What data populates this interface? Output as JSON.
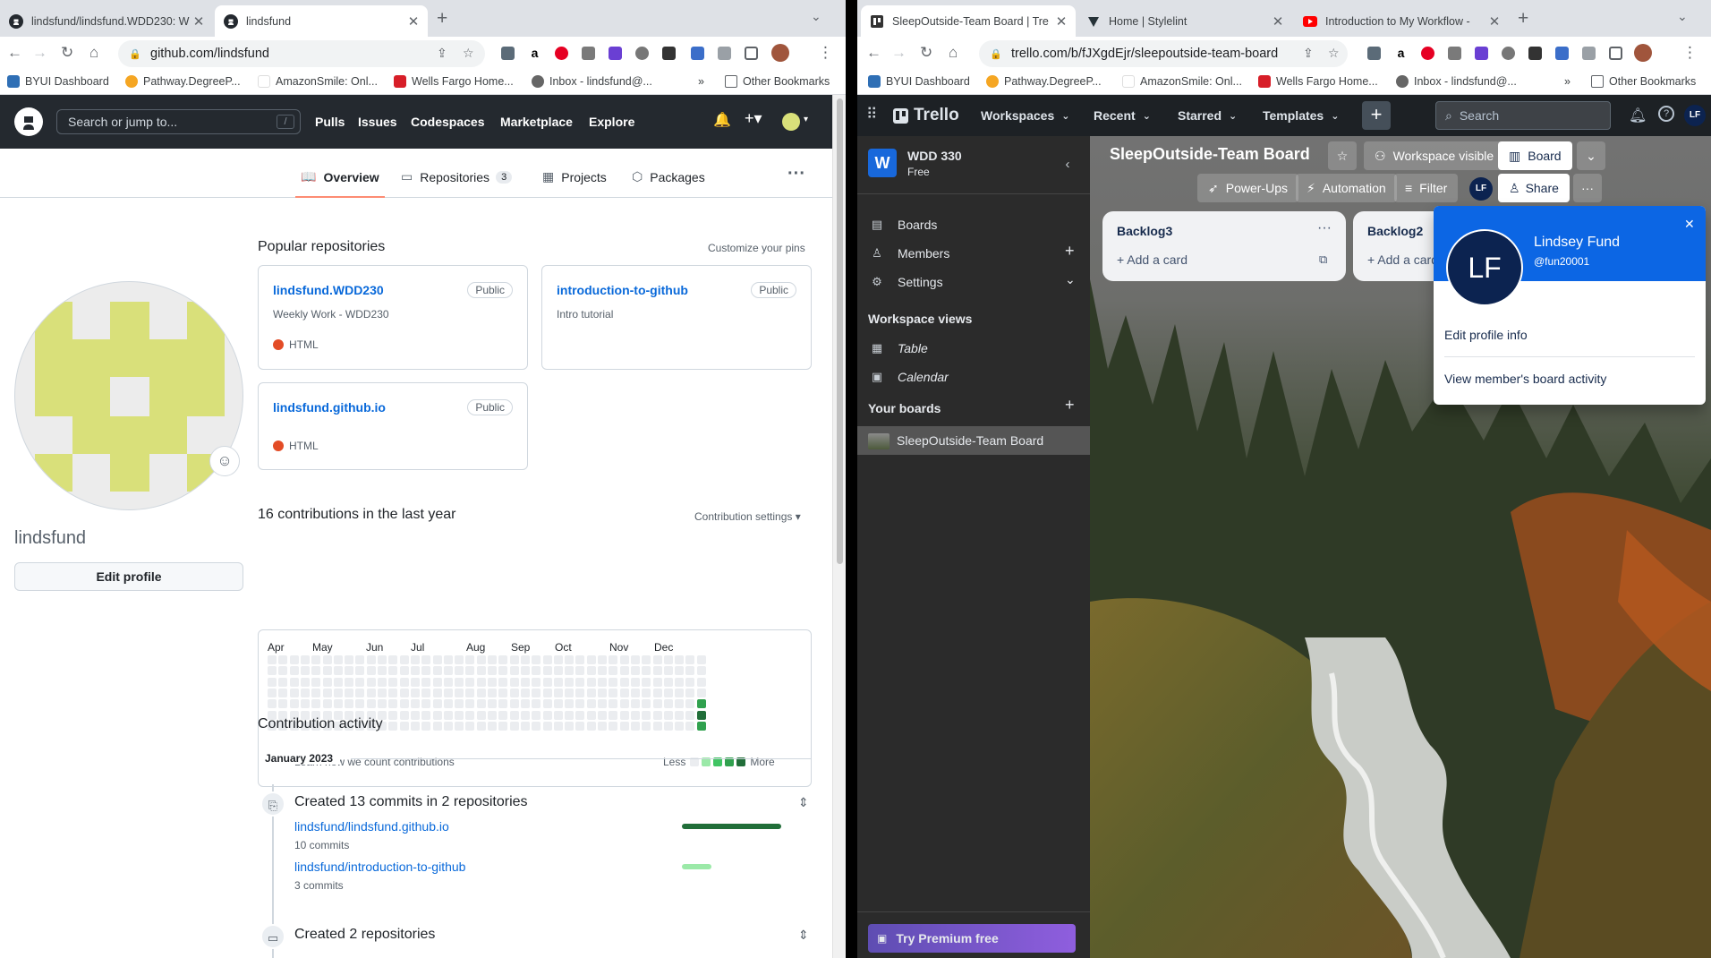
{
  "left_browser": {
    "tabs": [
      {
        "title": "lindsfund/lindsfund.WDD230: W",
        "active": false
      },
      {
        "title": "lindsfund",
        "active": true
      }
    ],
    "url": "github.com/lindsfund",
    "bookmarks": [
      "BYUI Dashboard",
      "Pathway.DegreeP...",
      "AmazonSmile: Onl...",
      "Wells Fargo Home...",
      "Inbox - lindsfund@...",
      "Other Bookmarks"
    ],
    "overflow": "»"
  },
  "right_browser": {
    "tabs": [
      {
        "title": "SleepOutside-Team Board | Tre",
        "active": true
      },
      {
        "title": "Home | Stylelint",
        "active": false
      },
      {
        "title": "Introduction to My Workflow -",
        "active": false
      }
    ],
    "url": "trello.com/b/fJXgdEjr/sleepoutside-team-board",
    "bookmarks": [
      "BYUI Dashboard",
      "Pathway.DegreeP...",
      "AmazonSmile: Onl...",
      "Wells Fargo Home...",
      "Inbox - lindsfund@...",
      "Other Bookmarks"
    ],
    "overflow": "»"
  },
  "github": {
    "search_placeholder": "Search or jump to...",
    "search_key": "/",
    "nav": [
      "Pulls",
      "Issues",
      "Codespaces",
      "Marketplace",
      "Explore"
    ],
    "profile_tabs": [
      {
        "label": "Overview",
        "count": null,
        "active": true
      },
      {
        "label": "Repositories",
        "count": "3",
        "active": false
      },
      {
        "label": "Projects",
        "count": null,
        "active": false
      },
      {
        "label": "Packages",
        "count": null,
        "active": false
      }
    ],
    "username": "lindsfund",
    "edit_profile": "Edit profile",
    "popular_title": "Popular repositories",
    "customize_pins": "Customize your pins",
    "repos": [
      {
        "name": "lindsfund.WDD230",
        "visibility": "Public",
        "description": "Weekly Work - WDD230",
        "language": "HTML"
      },
      {
        "name": "introduction-to-github",
        "visibility": "Public",
        "description": "Intro tutorial",
        "language": ""
      },
      {
        "name": "lindsfund.github.io",
        "visibility": "Public",
        "description": "",
        "language": "HTML"
      }
    ],
    "contrib_title": "16 contributions in the last year",
    "contrib_settings": "Contribution settings ▾",
    "months": [
      "Apr",
      "May",
      "Jun",
      "Jul",
      "Aug",
      "Sep",
      "Oct",
      "Nov",
      "Dec"
    ],
    "learn_link": "Learn how we count contributions",
    "legend_less": "Less",
    "legend_more": "More",
    "activity_title": "Contribution activity",
    "activity_month": "January 2023",
    "commits_heading": "Created 13 commits in 2 repositories",
    "commit_repos": [
      {
        "name": "lindsfund/lindsfund.github.io",
        "commits": "10 commits",
        "share": 1.0
      },
      {
        "name": "lindsfund/introduction-to-github",
        "commits": "3 commits",
        "share": 0.3
      }
    ],
    "created_repos_heading": "Created 2 repositories"
  },
  "trello": {
    "logo": "Trello",
    "nav": [
      "Workspaces",
      "Recent",
      "Starred",
      "Templates"
    ],
    "search_placeholder": "Search",
    "user_initials": "LF",
    "workspace": {
      "initial": "W",
      "name": "WDD 330",
      "plan": "Free"
    },
    "sidebar_items": [
      "Boards",
      "Members",
      "Settings"
    ],
    "views_title": "Workspace views",
    "views": [
      "Table",
      "Calendar"
    ],
    "your_boards": "Your boards",
    "boards": [
      "SleepOutside-Team Board"
    ],
    "premium": "Try Premium free",
    "board_title": "SleepOutside-Team Board",
    "visibility": "Workspace visible",
    "view_button": "Board",
    "toolbar": [
      "Power-Ups",
      "Automation",
      "Filter",
      "Share"
    ],
    "lists": [
      {
        "title": "Backlog3",
        "add": "Add a card"
      },
      {
        "title": "Backlog2",
        "add": "Add a card"
      }
    ],
    "member_popup": {
      "initials": "LF",
      "name": "Lindsey Fund",
      "handle": "@fun20001",
      "actions": [
        "Edit profile info",
        "View member's board activity"
      ]
    }
  }
}
